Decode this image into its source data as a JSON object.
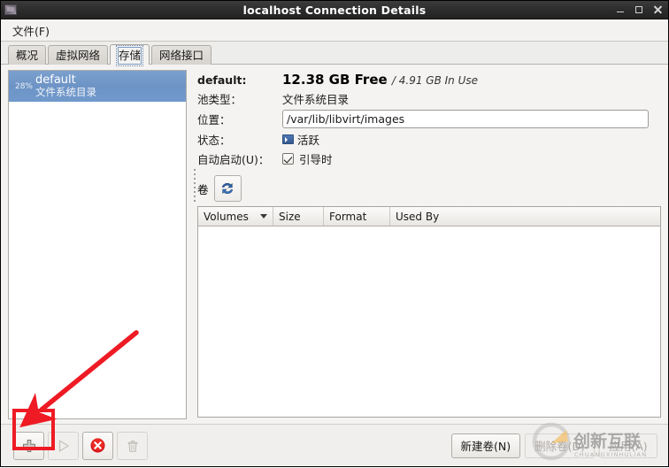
{
  "window": {
    "title": "localhost Connection Details",
    "app_icon": "virt-manager-icon",
    "controls": {
      "minimize": "minimize-icon",
      "maximize": "maximize-icon",
      "close": "close-icon"
    }
  },
  "menubar": {
    "items": [
      {
        "label": "文件(F)"
      }
    ]
  },
  "tabs": [
    {
      "label": "概况",
      "active": false
    },
    {
      "label": "虚拟网络",
      "active": false
    },
    {
      "label": "存储",
      "active": true
    },
    {
      "label": "网络接口",
      "active": false
    }
  ],
  "pool_list": {
    "items": [
      {
        "usage": "28%",
        "name": "default",
        "type": "文件系统目录",
        "selected": true
      }
    ]
  },
  "details": {
    "name_label": "default:",
    "free_value": "12.38 GB Free",
    "inuse_value": "/ 4.91 GB In Use",
    "pool_type_label": "池类型：",
    "pool_type_value": "文件系统目录",
    "location_label": "位置：",
    "location_value": "/var/lib/libvirt/images",
    "location_placeholder": "",
    "state_label": "状态：",
    "state_value": "活跃",
    "state_icon": "screen-icon",
    "autostart_label": "自动启动(U)：",
    "autostart_value": "引导时",
    "autostart_checked": true
  },
  "volumes": {
    "section_label": "卷",
    "refresh_icon": "refresh-icon",
    "columns": [
      {
        "label": "Volumes",
        "sort_icon": "chevron-down-icon"
      },
      {
        "label": "Size"
      },
      {
        "label": "Format"
      },
      {
        "label": "Used By"
      }
    ],
    "rows": []
  },
  "bottom_toolbar": {
    "left_buttons": [
      {
        "name": "add-pool-button",
        "icon": "plus-icon",
        "disabled": false
      },
      {
        "name": "start-pool-button",
        "icon": "play-icon",
        "disabled": true
      },
      {
        "name": "stop-pool-button",
        "icon": "stop-icon",
        "disabled": false
      },
      {
        "name": "delete-pool-button",
        "icon": "trash-icon",
        "disabled": true
      }
    ],
    "right_buttons": [
      {
        "label": "新建卷(N)",
        "disabled": false
      },
      {
        "label": "删除卷(D)",
        "disabled": true
      },
      {
        "label": "应用(A)",
        "disabled": true
      }
    ]
  },
  "annotation": {
    "highlight_color": "#ee1b24",
    "arrow": "red-arrow-pointing-to-add-button"
  },
  "watermark": {
    "text_cn": "创新互联",
    "text_en": "CHUANGXINHULIAN",
    "logo": "c-circle-logo",
    "accent_color": "#f5a623"
  }
}
